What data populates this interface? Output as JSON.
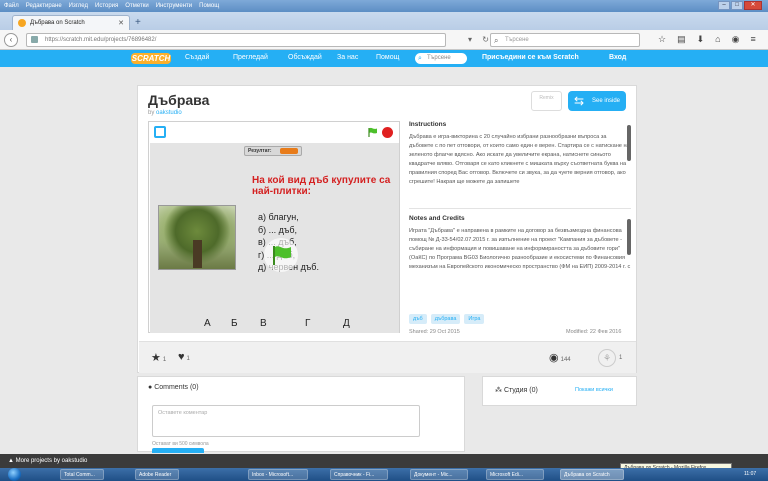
{
  "browser": {
    "menu": [
      "Файл",
      "Редактиране",
      "Изглед",
      "История",
      "Отметки",
      "Инструменти",
      "Помощ"
    ],
    "tab_title": "Дъбрава on Scratch",
    "url": "https://scratch.mit.edu/projects/76896482/",
    "search_placeholder": "Търсене"
  },
  "scratch_nav": {
    "logo": "SCRATCH",
    "items": [
      "Създай",
      "Прегледай",
      "Обсъждай",
      "За нас",
      "Помощ"
    ],
    "search_placeholder": "Търсене",
    "join": "Присъедини се към Scratch",
    "sign_in": "Вход"
  },
  "project": {
    "title": "Дъбрава",
    "by_prefix": "by",
    "author": "oakstudio",
    "remix_label": "Remix",
    "see_inside": "See inside",
    "stage": {
      "result_label": "Резултат:",
      "question": "На кой вид дъб купулите са най-плитки:",
      "answers": [
        "а) благун,",
        "б) ... дъб,",
        "в) ... дъб,",
        "г) ... дъб,",
        "д) червен дъб."
      ],
      "letters": [
        "А",
        "Б",
        "В",
        "Г",
        "Д"
      ]
    },
    "instructions_title": "Instructions",
    "instructions_text": "Дъбрава е игра-викторина с 20 случайно избрани разнообразни въпроса за дъбовете с по пет отговори, от които само един е верен. Стартира се с натискане на зеленото флагче вдясно. Ако искате да увеличите екрана, натиснете синьото квадратче вляво. Отговаря се като кликнете с мишката върху съответната буква на правилния според Вас отговор. Включете си звука, за да чуете верния отговор, ако сгрешите! Накрая ще можете да запишете",
    "notes_title": "Notes and Credits",
    "notes_text": "Играта \"Дъбрава\" е направена в рамките на договор за безвъзмездна финансова помощ № Д-33-54/02.07.2015 г. за изпълнение на проект \"Кампания за дъбовете - събиране на информация и повишаване на информираността за дъбовите гори\" (ОаКС) по Програма BG03 Биологично разнообразие и екосистеми по Финансовия механизъм на Европейското икономическо пространство (ФМ на ЕИП) 2009-2014 г. с",
    "tags": [
      "дъб",
      "дъбрава",
      "Игра"
    ],
    "shared": "Shared: 29 Oct 2015",
    "modified": "Modified: 22 Фев 2016",
    "favorites": "1",
    "loves": "1",
    "views": "144",
    "remixes": "1"
  },
  "comments": {
    "title": "Comments (0)",
    "placeholder": "Оставете коментар",
    "limit_text": "Остават ви 500 символа"
  },
  "studios": {
    "title": "Студия (0)",
    "view_all": "Покажи всички"
  },
  "footer": {
    "more_projects": "More projects by oakstudio",
    "tooltip": "Дъбрава on Scratch - Mozilla Firefox"
  },
  "taskbar": {
    "items": [
      "Total Comm...",
      "Adobe Reader",
      "Inbox - Microsoft...",
      "Справочник - Fi...",
      "Документ - Mic...",
      "Microsoft Edi...",
      "Дъбрава on Scratch"
    ],
    "time": "11:07"
  },
  "colors": {
    "scratch_blue": "#25aff4",
    "logo_orange": "#fbb02c",
    "question_red": "#d42020"
  }
}
